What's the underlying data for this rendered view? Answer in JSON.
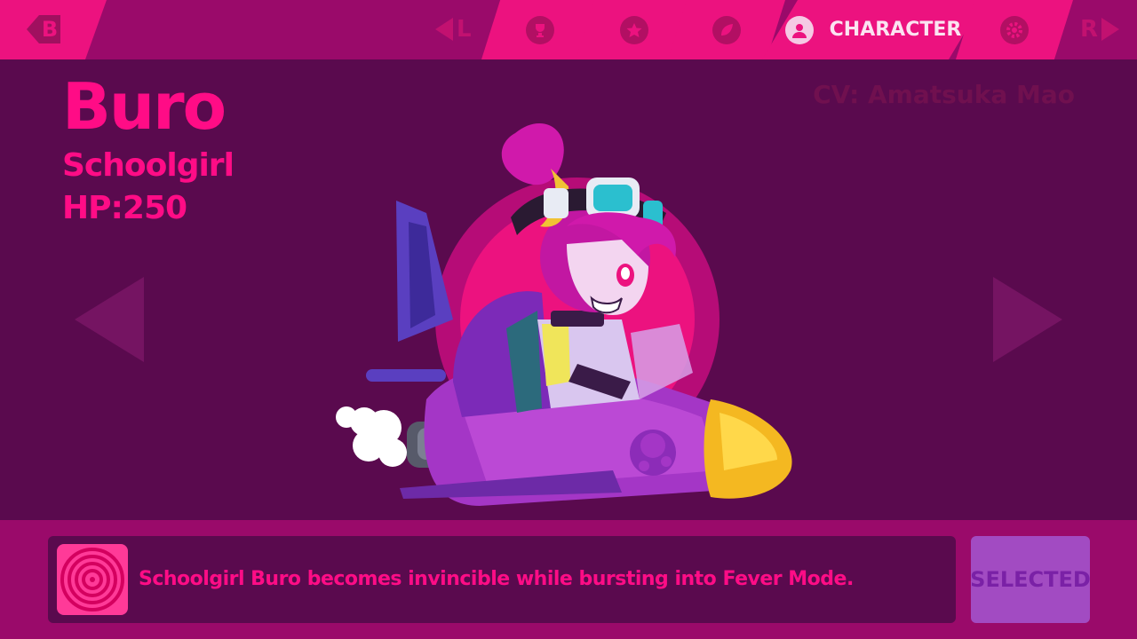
{
  "topbar": {
    "back_key": "B",
    "left_key": "L",
    "right_key": "R",
    "tabs": [
      {
        "icon": "trophy-icon",
        "label": ""
      },
      {
        "icon": "star-icon",
        "label": ""
      },
      {
        "icon": "leaf-icon",
        "label": ""
      },
      {
        "icon": "user-icon",
        "label": "CHARACTER",
        "active": true
      },
      {
        "icon": "gear-icon",
        "label": ""
      }
    ]
  },
  "character": {
    "name": "Buro",
    "variant": "Schoolgirl",
    "hp": "HP:250",
    "cv": "CV: Amatsuka Mao"
  },
  "skill": {
    "icon": "spiral-icon",
    "description": "Schoolgirl Buro becomes invincible while bursting into Fever Mode."
  },
  "select_button": {
    "label": "SELECTED"
  },
  "colors": {
    "accent": "#ec127f",
    "background": "#5a0a4e",
    "bar": "#9a0a6a",
    "text": "#ff0c86",
    "selected": "#a24bc2"
  }
}
